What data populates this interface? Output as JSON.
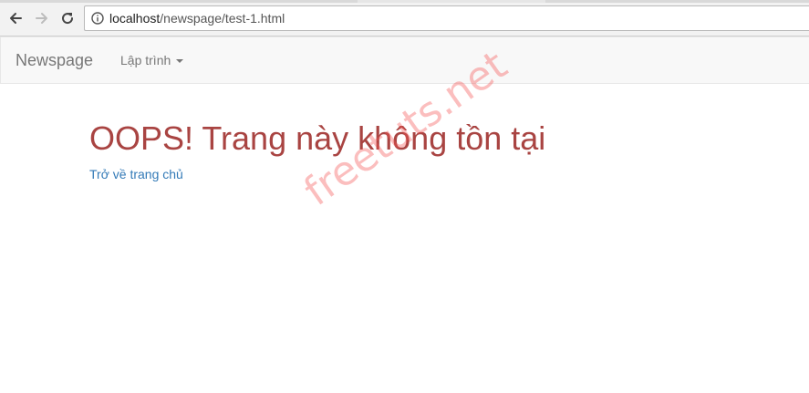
{
  "browser": {
    "url_host": "localhost",
    "url_path": "/newspage/test-1.html",
    "icons": {
      "back": "back-arrow-icon",
      "forward": "forward-arrow-icon",
      "reload": "reload-icon",
      "info": "info-icon"
    }
  },
  "navbar": {
    "brand": "Newspage",
    "dropdown_label": "Lập trình"
  },
  "main": {
    "title": "OOPS! Trang này không tồn tại",
    "home_link": "Trở về trang chủ"
  },
  "watermark": {
    "text": "freetuts.net"
  },
  "colors": {
    "title": "#a94442",
    "link": "#337ab7",
    "navbar_text": "#777777",
    "navbar_bg": "#f8f8f8",
    "watermark": "#f45454"
  }
}
